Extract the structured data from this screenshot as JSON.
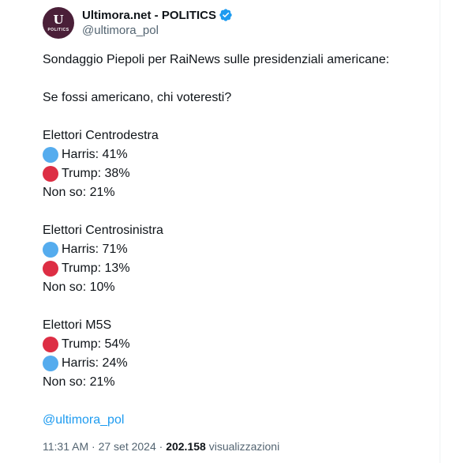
{
  "author": {
    "display_name": "Ultimora.net - POLITICS",
    "handle": "@ultimora_pol",
    "avatar_logo": "U",
    "avatar_sub": "POLITICS",
    "verified_icon": "verified-badge-icon"
  },
  "tweet": {
    "intro": "Sondaggio Piepoli per RaiNews sulle presidenziali americane:",
    "question": "Se fossi americano, chi voteresti?",
    "groups": [
      {
        "title": "Elettori Centrodestra",
        "rows": [
          {
            "dot": "blue",
            "text": "Harris: 41%"
          },
          {
            "dot": "red",
            "text": "Trump: 38%"
          },
          {
            "dot": "",
            "text": "Non so: 21%"
          }
        ]
      },
      {
        "title": "Elettori Centrosinistra",
        "rows": [
          {
            "dot": "blue",
            "text": "Harris: 71%"
          },
          {
            "dot": "red",
            "text": "Trump: 13%"
          },
          {
            "dot": "",
            "text": "Non so: 10%"
          }
        ]
      },
      {
        "title": "Elettori M5S",
        "rows": [
          {
            "dot": "red",
            "text": "Trump: 54%"
          },
          {
            "dot": "blue",
            "text": "Harris: 24%"
          },
          {
            "dot": "",
            "text": "Non so: 21%"
          }
        ]
      }
    ],
    "mention": "@ultimora_pol"
  },
  "meta": {
    "time": "11:31 AM",
    "sep1": " · ",
    "date": "27 set 2024",
    "sep2": " · ",
    "views_count": "202.158",
    "views_label": " visualizzazioni"
  },
  "colors": {
    "blue_dot": "#55acee",
    "red_dot": "#dd2e44",
    "link": "#1d9bf0",
    "verified": "#1d9bf0"
  }
}
